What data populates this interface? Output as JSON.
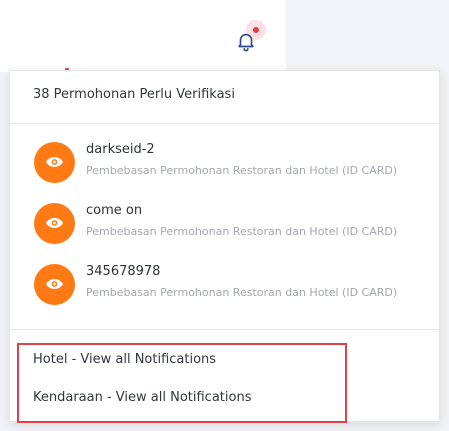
{
  "topbar": {
    "bell_icon": "bell-icon",
    "has_unread": true
  },
  "dropdown": {
    "header": "38 Permohonan Perlu Verifikasi",
    "items": [
      {
        "title": "darkseid-2",
        "description": "Pembebasan Permohonan Restoran dan Hotel (ID CARD)",
        "icon": "eye-icon"
      },
      {
        "title": "come on",
        "description": "Pembebasan Permohonan Restoran dan Hotel (ID CARD)",
        "icon": "eye-icon"
      },
      {
        "title": "345678978",
        "description": "Pembebasan Permohonan Restoran dan Hotel (ID CARD)",
        "icon": "eye-icon"
      }
    ],
    "footer_links": [
      {
        "label": "Hotel - View all Notifications"
      },
      {
        "label": "Kendaraan - View all Notifications"
      }
    ]
  },
  "colors": {
    "accent": "#ff7a14",
    "alert": "#e0404c",
    "highlight_box": "#e0414a"
  }
}
